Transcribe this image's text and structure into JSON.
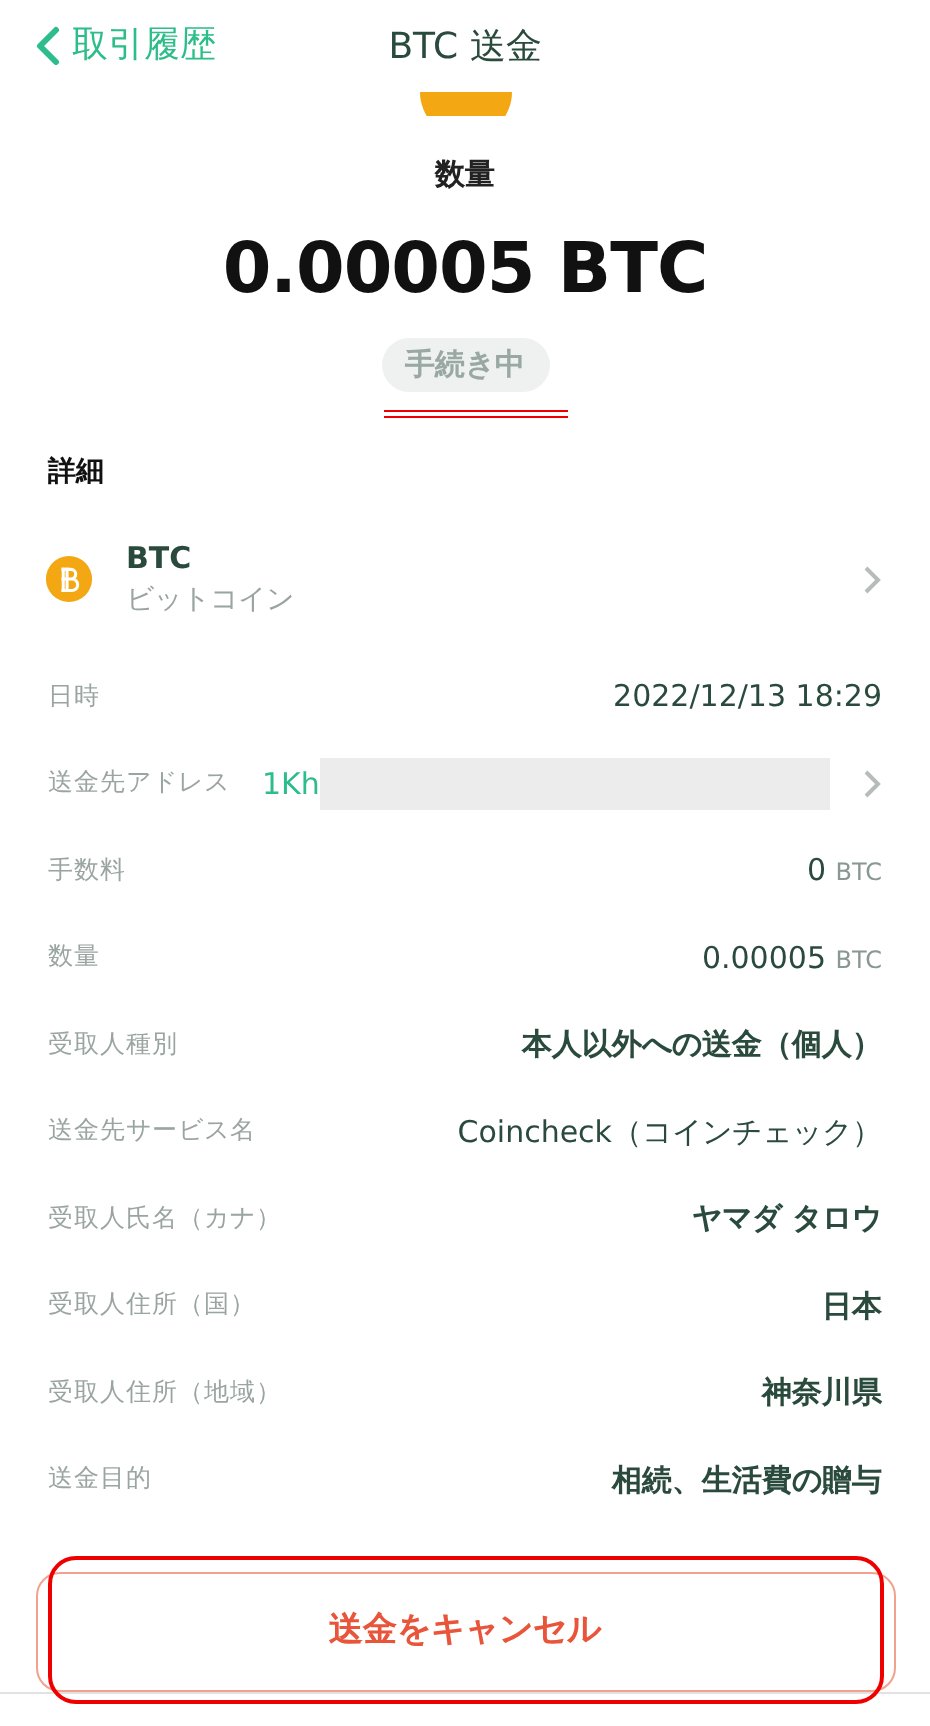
{
  "header": {
    "back_label": "取引履歴",
    "title": "BTC 送金"
  },
  "summary": {
    "label": "数量",
    "amount": "0.00005 BTC",
    "status": "手続き中",
    "status_marked": true
  },
  "details": {
    "heading": "詳細",
    "coin": {
      "symbol": "BTC",
      "name": "ビットコイン"
    },
    "rows": [
      {
        "kind": "text",
        "label": "日時",
        "value": "2022/12/13 18:29"
      },
      {
        "kind": "address",
        "label": "送金先アドレス",
        "value": "1Kh",
        "redacted": true
      },
      {
        "kind": "amount",
        "label": "手数料",
        "value": "0",
        "unit": "BTC"
      },
      {
        "kind": "amount",
        "label": "数量",
        "value": "0.00005",
        "unit": "BTC"
      },
      {
        "kind": "strong",
        "label": "受取人種別",
        "value": "本人以外への送金（個人）"
      },
      {
        "kind": "text",
        "label": "送金先サービス名",
        "value": "Coincheck（コインチェック）"
      },
      {
        "kind": "strong",
        "label": "受取人氏名（カナ）",
        "value": "ヤマダ タロウ"
      },
      {
        "kind": "strong",
        "label": "受取人住所（国）",
        "value": "日本"
      },
      {
        "kind": "strong",
        "label": "受取人住所（地域）",
        "value": "神奈川県"
      },
      {
        "kind": "strong",
        "label": "送金目的",
        "value": "相続、生活費の贈与"
      }
    ]
  },
  "cancel_button": {
    "label": "送金をキャンセル",
    "marked": true
  }
}
